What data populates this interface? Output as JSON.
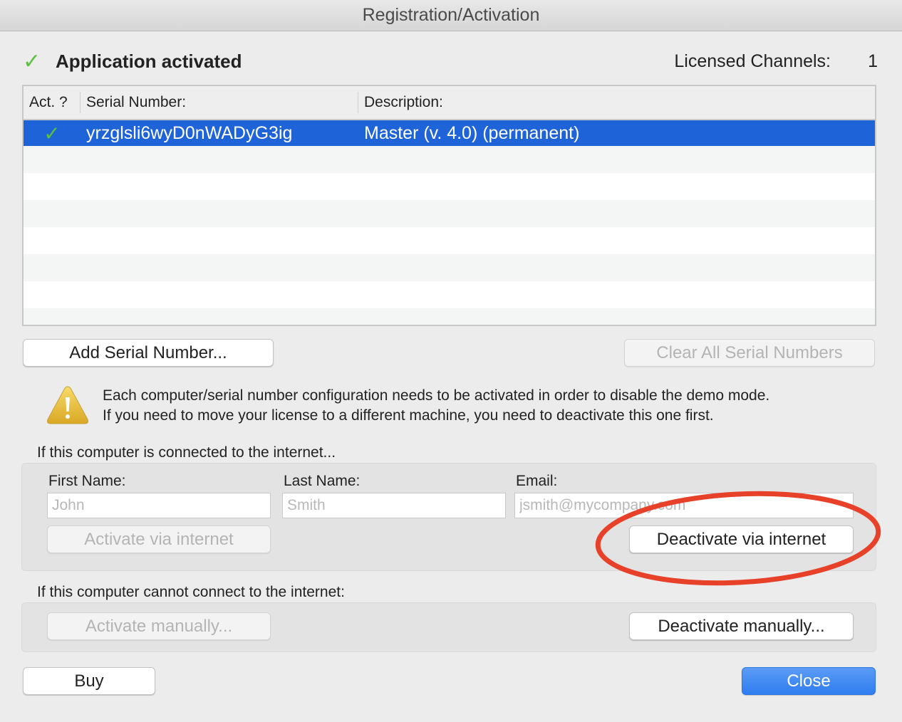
{
  "window": {
    "title": "Registration/Activation"
  },
  "status": {
    "icon": "checkmark-icon",
    "text": "Application activated",
    "licensed_channels_label": "Licensed Channels:",
    "licensed_channels_value": "1"
  },
  "serial_table": {
    "columns": [
      "Act. ?",
      "Serial Number:",
      "Description:"
    ],
    "rows": [
      {
        "activated": true,
        "serial": "yrzglsli6wyD0nWADyG3ig",
        "description": "Master (v. 4.0)  (permanent)",
        "selected": true
      }
    ],
    "selection_color": "#1f63d8"
  },
  "buttons": {
    "add_serial": "Add Serial Number...",
    "clear_all": "Clear All Serial Numbers",
    "activate_internet": "Activate via internet",
    "deactivate_internet": "Deactivate via internet",
    "activate_manual": "Activate manually...",
    "deactivate_manual": "Deactivate manually...",
    "buy": "Buy",
    "close": "Close"
  },
  "warning": {
    "icon": "warning-icon",
    "line1": "Each computer/serial number configuration needs to be activated in order to disable the demo mode.",
    "line2": "If you need to move your license to a different machine, you need to deactivate this one first."
  },
  "online_section": {
    "label": "If this computer is connected to the internet...",
    "first_name": {
      "label": "First Name:",
      "value": "",
      "placeholder": "John"
    },
    "last_name": {
      "label": "Last Name:",
      "value": "",
      "placeholder": "Smith"
    },
    "email": {
      "label": "Email:",
      "value": "",
      "placeholder": "jsmith@mycompany.com"
    }
  },
  "offline_section": {
    "label": "If this computer cannot connect to the internet:"
  },
  "annotation": {
    "shape": "ellipse",
    "color": "#e8412a",
    "target": "deactivate_internet"
  }
}
